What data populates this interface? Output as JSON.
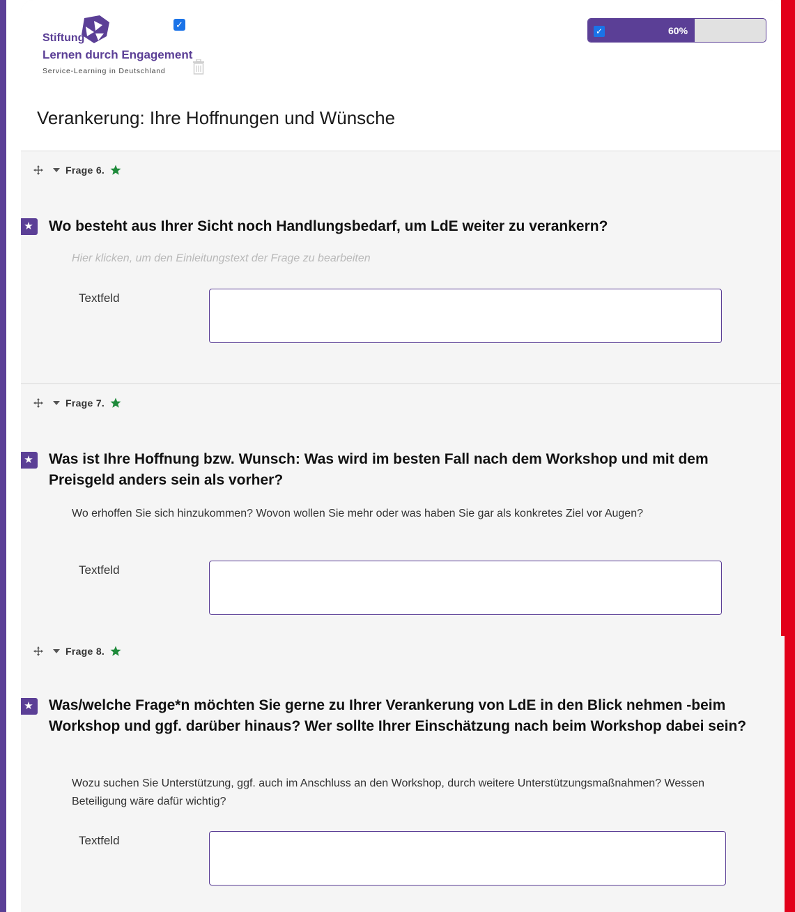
{
  "header": {
    "logo": {
      "line1": "Stiftung",
      "line2": "Lernen durch Engagement",
      "line3": "Service-Learning in Deutschland"
    },
    "progress": {
      "percent": 60,
      "label": "60%"
    },
    "page_title": "Verankerung: Ihre Hoffnungen und Wünsche"
  },
  "questions": [
    {
      "head": "Frage 6.",
      "title": "Wo besteht aus Ihrer Sicht noch Handlungsbedarf, um LdE weiter zu verankern?",
      "intro": "Hier klicken, um den Einleitungstext der Frage zu bearbeiten",
      "field_label": "Textfeld"
    },
    {
      "head": "Frage 7.",
      "title": "Was ist Ihre Hoffnung bzw. Wunsch: Was wird im besten Fall nach dem Workshop und mit dem Preisgeld anders sein als vorher?",
      "intro": "Wo erhoffen Sie sich hinzukommen? Wovon wollen Sie mehr oder was haben Sie gar als konkretes Ziel vor Augen?",
      "field_label": "Textfeld"
    },
    {
      "head": "Frage 8.",
      "title": "Was/welche Frage*n möchten Sie gerne zu Ihrer Verankerung von LdE in den Blick nehmen -beim Workshop und ggf. darüber hinaus? Wer sollte Ihrer Einschätzung nach beim Workshop dabei sein?",
      "intro": "Wozu suchen Sie Unterstützung, ggf. auch im Anschluss an den Workshop, durch weitere Unterstützungsmaßnahmen? Wessen Beteiligung wäre dafür wichtig?",
      "field_label": "Textfeld"
    }
  ],
  "icons": {
    "move": "move-icon",
    "caret": "caret-down-icon",
    "star": "star-icon",
    "check": "checkbox-icon",
    "trash": "trash-icon"
  },
  "colors": {
    "brand_purple": "#5b3f96",
    "accent_red": "#e2001a",
    "check_blue": "#1a73e8",
    "star_green": "#1e8a3a"
  }
}
